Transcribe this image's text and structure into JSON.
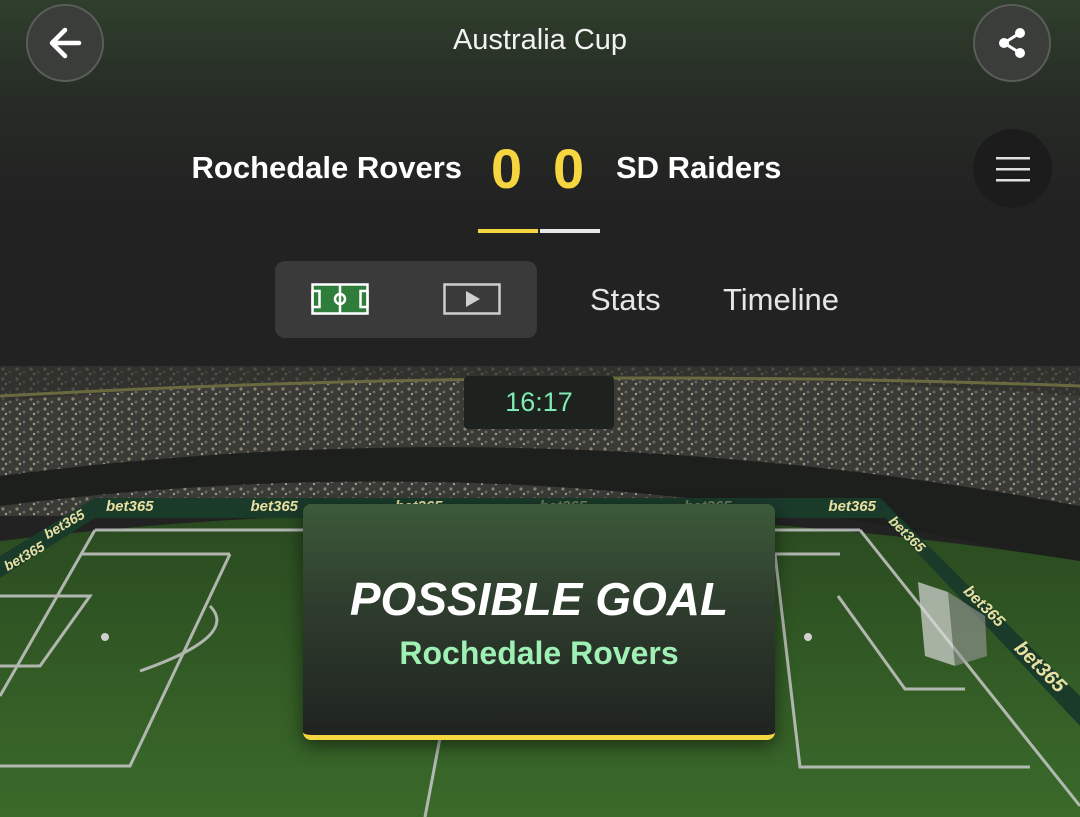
{
  "header": {
    "title": "Australia Cup",
    "back_icon": "back-arrow-icon",
    "share_icon": "share-icon",
    "menu_icon": "hamburger-menu-icon"
  },
  "match": {
    "home_team": "Rochedale Rovers",
    "away_team": "SD Raiders",
    "home_score": "0",
    "away_score": "0"
  },
  "view_toggle": {
    "pitch_icon": "pitch-icon",
    "video_icon": "play-video-icon"
  },
  "tabs": [
    {
      "label": "Stats"
    },
    {
      "label": "Timeline"
    }
  ],
  "stadium": {
    "clock": "16:17",
    "ad_board_text": "bet365",
    "event": {
      "title": "POSSIBLE GOAL",
      "team": "Rochedale Rovers"
    }
  },
  "colors": {
    "accent_yellow": "#f5d640",
    "clock_green": "#7fe9b2",
    "team_green": "#9ef0b4",
    "pitch_green": "#2f5a22"
  }
}
